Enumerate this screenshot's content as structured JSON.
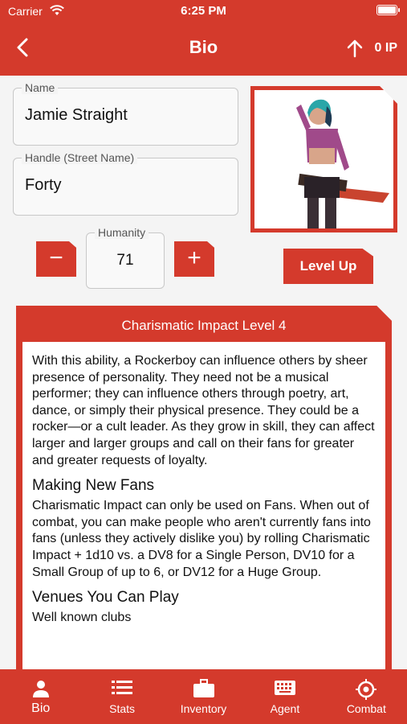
{
  "status_bar": {
    "carrier": "Carrier",
    "time": "6:25 PM"
  },
  "header": {
    "title": "Bio",
    "ip": "0 IP"
  },
  "fields": {
    "name": {
      "label": "Name",
      "value": "Jamie Straight"
    },
    "handle": {
      "label": "Handle (Street Name)",
      "value": "Forty"
    },
    "humanity": {
      "label": "Humanity",
      "value": "71"
    }
  },
  "buttons": {
    "decrement": "−",
    "increment": "+",
    "level_up": "Level Up"
  },
  "ability": {
    "title": "Charismatic Impact Level 4",
    "intro": "With this ability, a Rockerboy can influence others by sheer presence of personality. They need not be a musical performer; they can influence others through poetry, art, dance, or simply their physical presence. They could be a rocker—or a cult leader. As they grow in skill, they can affect larger and larger groups and call on their fans for greater and greater requests of loyalty.",
    "section1_heading": "Making New Fans",
    "section1_text": "Charismatic Impact can only be used on Fans. When out of combat, you can make people who aren't currently fans into fans (unless they actively dislike you) by rolling Charismatic Impact + 1d10 vs. a DV8 for a Single Person, DV10 for a Small Group of up to 6, or DV12 for a Huge Group.",
    "section2_heading": "Venues You Can Play",
    "section2_text": "Well known clubs"
  },
  "tabs": [
    {
      "label": "Bio",
      "icon": "person-icon",
      "active": true
    },
    {
      "label": "Stats",
      "icon": "list-icon"
    },
    {
      "label": "Inventory",
      "icon": "briefcase-icon"
    },
    {
      "label": "Agent",
      "icon": "keyboard-icon"
    },
    {
      "label": "Combat",
      "icon": "crosshair-icon"
    }
  ],
  "colors": {
    "accent": "#d43a2c",
    "background": "#f4f4f4"
  }
}
